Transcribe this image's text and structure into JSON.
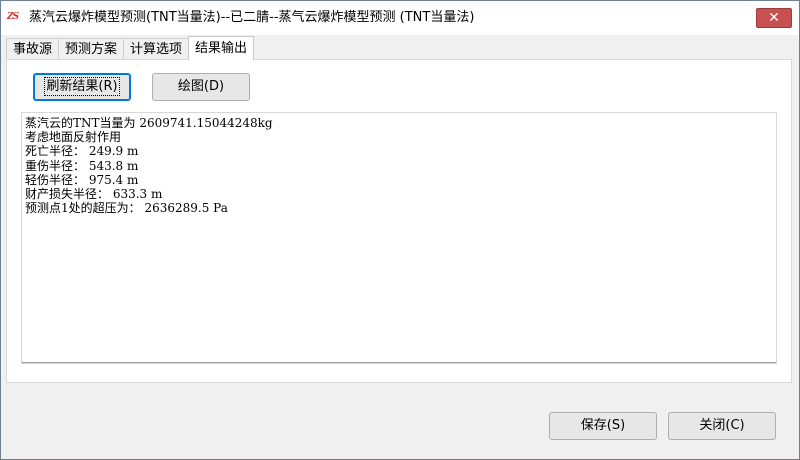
{
  "window": {
    "title": "蒸汽云爆炸模型预测(TNT当量法)--已二腈--蒸气云爆炸模型预测 (TNT当量法)",
    "icon_text": "ZS",
    "close_glyph": "✕"
  },
  "tabs": [
    {
      "label": "事故源"
    },
    {
      "label": "预测方案"
    },
    {
      "label": "计算选项"
    },
    {
      "label": "结果输出"
    }
  ],
  "active_tab": "结果输出",
  "toolbar": {
    "refresh_label": "刷新结果(R)",
    "plot_label": "绘图(D)"
  },
  "output_lines": [
    "蒸汽云的TNT当量为 2609741.15044248kg",
    "考虑地面反射作用",
    "死亡半径： 249.9 m",
    "重伤半径： 543.8 m",
    "轻伤半径： 975.4 m",
    "财产损失半径： 633.3 m",
    "预测点1处的超压为： 2636289.5 Pa"
  ],
  "footer": {
    "save_label": "保存(S)",
    "close_label": "关闭(C)"
  },
  "colors": {
    "close_button": "#c75050",
    "focus_border": "#0078d7",
    "window_bg": "#f0f0f0"
  }
}
